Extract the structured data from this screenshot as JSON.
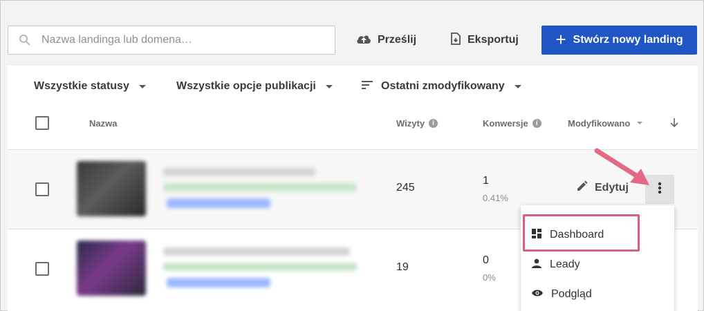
{
  "toolbar": {
    "search_placeholder": "Nazwa landinga lub domena…",
    "upload_label": "Prześlij",
    "export_label": "Eksportuj",
    "create_label": "Stwórz nowy landing",
    "primary_color": "#1f55c4"
  },
  "filters": {
    "status": "Wszystkie statusy",
    "publication": "Wszystkie opcje publikacji",
    "sort": "Ostatni zmodyfikowany"
  },
  "table": {
    "columns": {
      "name": "Nazwa",
      "visits": "Wizyty",
      "conversions": "Konwersje",
      "modified": "Modyfikowano"
    },
    "rows": [
      {
        "visits": "245",
        "conversions": "1",
        "conversion_rate": "0.41%"
      },
      {
        "visits": "19",
        "conversions": "0",
        "conversion_rate": "0%"
      }
    ],
    "edit_label": "Edytuj"
  },
  "context_menu": {
    "items": [
      {
        "label": "Dashboard",
        "icon": "dashboard-icon"
      },
      {
        "label": "Leady",
        "icon": "person-icon"
      },
      {
        "label": "Podgląd",
        "icon": "eye-icon"
      }
    ],
    "highlight_color": "#d9607c"
  }
}
